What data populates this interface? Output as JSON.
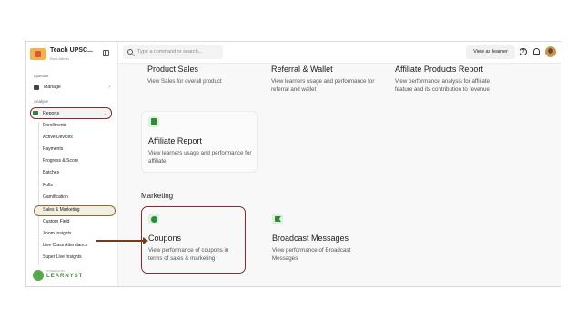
{
  "brand": {
    "name": "Teach UPSC...",
    "subtitle": "Root Admin"
  },
  "sidebar": {
    "operate_label": "Operate",
    "manage_label": "Manage",
    "analyse_label": "Analyse",
    "reports_label": "Reports",
    "report_items": [
      "Enrollments",
      "Active Devices",
      "Payments",
      "Progress & Score",
      "Batches",
      "Polls",
      "Gamification",
      "Sales & Marketing",
      "Custom Field",
      "Zoom Insights",
      "Live Class Attendance",
      "Super Live Insights"
    ],
    "footer_pre": "POWERED BY",
    "footer_brand": "LEARNYST"
  },
  "topbar": {
    "search_placeholder": "Type a command or search...",
    "view_as_learner": "View as learner"
  },
  "cards": {
    "product_sales": {
      "title": "Product Sales",
      "desc": "View Sales for overall product"
    },
    "referral_wallet": {
      "title": "Referral & Wallet",
      "desc": "View learners usage and performance for referral and wallet"
    },
    "affiliate_products": {
      "title": "Affiliate Products Report",
      "desc": "View performance analysis for affiliate feature and its contribution to revenue"
    },
    "affiliate_report": {
      "title": "Affiliate Report",
      "desc": "View learners usage and performance for affiliate"
    },
    "marketing_heading": "Marketing",
    "coupons": {
      "title": "Coupons",
      "desc": "View performance of coupons in terms of sales & marketing"
    },
    "broadcast": {
      "title": "Broadcast Messages",
      "desc": "View performance of Broadcast Messages"
    }
  },
  "colors": {
    "accent_green": "#2f8a3c",
    "highlight_border": "#8b2a2a",
    "arrow": "#7a3a1c"
  }
}
